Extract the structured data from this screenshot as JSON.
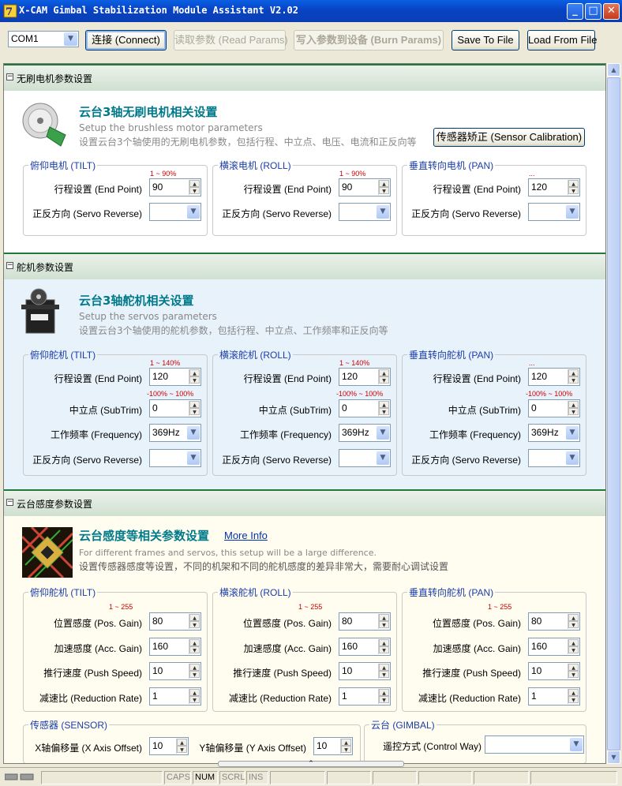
{
  "window": {
    "title": "X-CAM Gimbal Stabilization Module Assistant V2.02",
    "minimize": "_",
    "maximize": "□",
    "close": "✕"
  },
  "toolbar": {
    "port": "COM1",
    "connect": "连接 (Connect)",
    "read": "读取参数 (Read Params)",
    "burn": "写入参数到设备 (Burn Params)",
    "save": "Save To File",
    "load": "Load From File"
  },
  "motor": {
    "header": "无刷电机参数设置",
    "title": "云台3轴无刷电机相关设置",
    "sub_en": "Setup the brushless motor parameters",
    "sub_cn": "设置云台3个轴使用的无刷电机参数，包括行程、中立点、电压、电流和正反向等",
    "calib": "传感器矫正 (Sensor Calibration)",
    "groups": [
      {
        "label": "俯仰电机 (TILT)",
        "range": "1 ~ 90%",
        "endpoint_label": "行程设置 (End Point)",
        "endpoint": "90",
        "reverse_label": "正反方向 (Servo Reverse)",
        "reverse": ""
      },
      {
        "label": "横滚电机 (ROLL)",
        "range": "1 ~ 90%",
        "endpoint_label": "行程设置 (End Point)",
        "endpoint": "90",
        "reverse_label": "正反方向 (Servo Reverse)",
        "reverse": ""
      },
      {
        "label": "垂直转向电机 (PAN)",
        "range": "...",
        "endpoint_label": "行程设置 (End Point)",
        "endpoint": "120",
        "reverse_label": "正反方向 (Servo Reverse)",
        "reverse": ""
      }
    ]
  },
  "servo": {
    "header": "舵机参数设置",
    "title": "云台3轴舵机相关设置",
    "sub_en": "Setup the servos parameters",
    "sub_cn": "设置云台3个轴使用的舵机参数，包括行程、中立点、工作频率和正反向等",
    "groups": [
      {
        "label": "俯仰舵机 (TILT)",
        "range1": "1 ~ 140%",
        "endpoint_label": "行程设置 (End Point)",
        "endpoint": "120",
        "range2": "-100% ~ 100%",
        "subtrim_label": "中立点 (SubTrim)",
        "subtrim": "0",
        "freq_label": "工作频率 (Frequency)",
        "freq": "369Hz",
        "reverse_label": "正反方向 (Servo Reverse)",
        "reverse": ""
      },
      {
        "label": "横滚舵机 (ROLL)",
        "range1": "1 ~ 140%",
        "endpoint_label": "行程设置 (End Point)",
        "endpoint": "120",
        "range2": "-100% ~ 100%",
        "subtrim_label": "中立点 (SubTrim)",
        "subtrim": "0",
        "freq_label": "工作频率 (Frequency)",
        "freq": "369Hz",
        "reverse_label": "正反方向 (Servo Reverse)",
        "reverse": ""
      },
      {
        "label": "垂直转向舵机 (PAN)",
        "range1": "...",
        "endpoint_label": "行程设置 (End Point)",
        "endpoint": "120",
        "range2": "-100% ~ 100%",
        "subtrim_label": "中立点 (SubTrim)",
        "subtrim": "0",
        "freq_label": "工作频率 (Frequency)",
        "freq": "369Hz",
        "reverse_label": "正反方向 (Servo Reverse)",
        "reverse": ""
      }
    ]
  },
  "gain": {
    "header": "云台感度参数设置",
    "title": "云台感度等相关参数设置",
    "more": "More Info",
    "sub_en": "For different frames and servos, this setup will be a large difference.",
    "sub_cn": "设置传感器感度等设置，不同的机架和不同的舵机感度的差异非常大，需要耐心调试设置",
    "groups": [
      {
        "label": "俯仰舵机 (TILT)",
        "range": "1 ~ 255",
        "pos_label": "位置感度 (Pos. Gain)",
        "pos": "80",
        "acc_label": "加速感度 (Acc. Gain)",
        "acc": "160",
        "push_label": "推行速度 (Push Speed)",
        "push": "10",
        "red_label": "减速比 (Reduction Rate)",
        "red": "1"
      },
      {
        "label": "横滚舵机 (ROLL)",
        "range": "1 ~ 255",
        "pos_label": "位置感度 (Pos. Gain)",
        "pos": "80",
        "acc_label": "加速感度 (Acc. Gain)",
        "acc": "160",
        "push_label": "推行速度 (Push Speed)",
        "push": "10",
        "red_label": "减速比 (Reduction Rate)",
        "red": "1"
      },
      {
        "label": "垂直转向舵机 (PAN)",
        "range": "1 ~ 255",
        "pos_label": "位置感度 (Pos. Gain)",
        "pos": "80",
        "acc_label": "加速感度 (Acc. Gain)",
        "acc": "160",
        "push_label": "推行速度 (Push Speed)",
        "push": "10",
        "red_label": "减速比 (Reduction Rate)",
        "red": "1"
      }
    ],
    "sensor": {
      "label": "传感器 (SENSOR)",
      "x_label": "X轴偏移量 (X Axis Offset)",
      "x": "10",
      "y_label": "Y轴偏移量 (Y Axis Offset)",
      "y": "10"
    },
    "gimbal": {
      "label": "云台 (GIMBAL)",
      "control_label": "遥控方式 (Control Way)",
      "control": ""
    }
  },
  "status": {
    "caps": "CAPS",
    "num": "NUM",
    "scrl": "SCRL",
    "ins": "INS"
  }
}
